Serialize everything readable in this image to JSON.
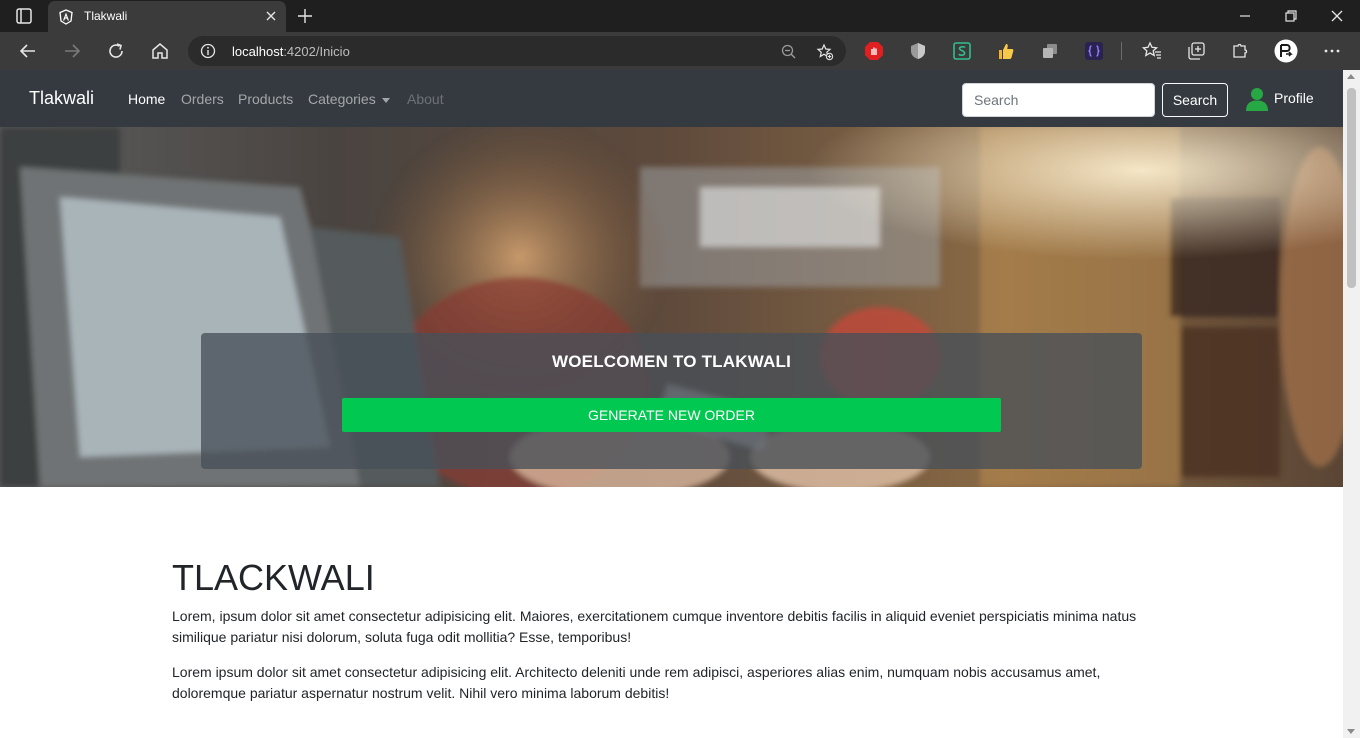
{
  "browser": {
    "tab_title": "Tlakwali",
    "address_host": "localhost",
    "address_path": ":4202/Inicio"
  },
  "navbar": {
    "brand": "Tlakwali",
    "links": [
      {
        "label": "Home",
        "state": "active"
      },
      {
        "label": "Orders",
        "state": "normal"
      },
      {
        "label": "Products",
        "state": "normal"
      },
      {
        "label": "Categories",
        "state": "dropdown"
      },
      {
        "label": "About",
        "state": "disabled"
      }
    ],
    "search_placeholder": "Search",
    "search_button": "Search",
    "profile_label": "Profile"
  },
  "hero": {
    "title": "WOELCOMEN TO TLAKWALI",
    "button": "GENERATE NEW ORDER"
  },
  "content": {
    "heading": "TLACKWALI",
    "paragraph1": "Lorem, ipsum dolor sit amet consectetur adipisicing elit. Maiores, exercitationem cumque inventore debitis facilis in aliquid eveniet perspiciatis minima natus similique pariatur nisi dolorum, soluta fuga odit mollitia? Esse, temporibus!",
    "paragraph2": "Lorem ipsum dolor sit amet consectetur adipisicing elit. Architecto deleniti unde rem adipisci, asperiores alias enim, numquam nobis accusamus amet, doloremque pariatur aspernatur nostrum velit. Nihil vero minima laborum debitis!"
  },
  "colors": {
    "navbar_bg": "#343a40",
    "hero_button": "#00c851",
    "profile_icon": "#28a745"
  }
}
